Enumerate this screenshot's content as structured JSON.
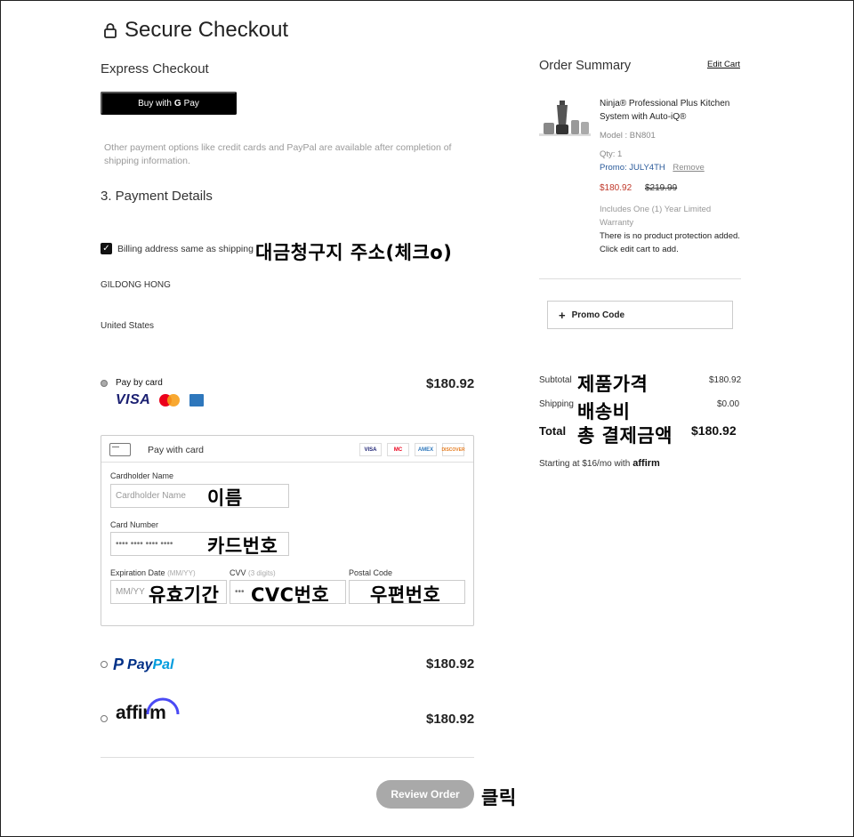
{
  "header": {
    "title": "Secure Checkout",
    "express_checkout": "Express Checkout",
    "gpay_prefix": "Buy with",
    "gpay_g": "G",
    "gpay_pay": "Pay",
    "other_note": "Other payment options like credit cards and PayPal are available after completion of shipping information."
  },
  "payment": {
    "section_title": "3. Payment Details",
    "billing_label": "Billing address same as shipping",
    "billing_checked": true,
    "name": "GILDONG HONG",
    "country": "United States",
    "pay_by_card": {
      "label": "Pay by card",
      "price": "$180.92",
      "visa": "VISA"
    },
    "card_panel": {
      "header": "Pay with card",
      "mini_logos": [
        "VISA",
        "MC",
        "AMEX",
        "DISCOVER"
      ],
      "cardholder_label": "Cardholder Name",
      "cardholder_placeholder": "Cardholder Name",
      "card_number_label": "Card Number",
      "card_number_placeholder": "•••• •••• •••• ••••",
      "expiration_label": "Expiration Date",
      "expiration_hint": "(MM/YY)",
      "expiration_placeholder": "MM/YY",
      "cvv_label": "CVV",
      "cvv_hint": "(3 digits)",
      "cvv_placeholder": "•••",
      "postal_label": "Postal Code"
    },
    "paypal": {
      "mark": "P",
      "pay": "Pay",
      "pal": "Pal",
      "price": "$180.92"
    },
    "affirm": {
      "label": "affirm",
      "price": "$180.92"
    },
    "review_button": "Review Order"
  },
  "summary": {
    "title": "Order Summary",
    "edit_cart": "Edit Cart",
    "product": {
      "name": "Ninja® Professional Plus Kitchen System with Auto-iQ®",
      "model": "Model : BN801",
      "qty": "Qty: 1",
      "promo": "Promo: JULY4TH",
      "remove": "Remove",
      "price": "$180.92",
      "old_price": "$219.99",
      "warranty": "Includes One (1) Year Limited Warranty",
      "protection": "There is no product protection added. Click edit cart to add."
    },
    "promo_code": "Promo Code",
    "subtotal_label": "Subtotal",
    "subtotal_value": "$180.92",
    "shipping_label": "Shipping",
    "shipping_value": "$0.00",
    "total_label": "Total",
    "total_value": "$180.92",
    "starting_text": "Starting at $16/mo with",
    "starting_brand": "affirm"
  },
  "annotations": {
    "billing": "대금청구지 주소(체크o)",
    "name": "이름",
    "card_number": "카드번호",
    "expiry": "유효기간",
    "cvc": "CVC번호",
    "postal": "우편번호",
    "click": "클릭",
    "subtotal": "제품가격",
    "shipping": "배송비",
    "total": "총 결제금액"
  },
  "colors": {
    "visa_blue": "#1a1f71",
    "paypal_dark": "#003087",
    "paypal_light": "#009cde",
    "promo_blue": "#2a5a9a",
    "sale_red": "#c0392b",
    "button_grey": "#a9a9a9"
  }
}
